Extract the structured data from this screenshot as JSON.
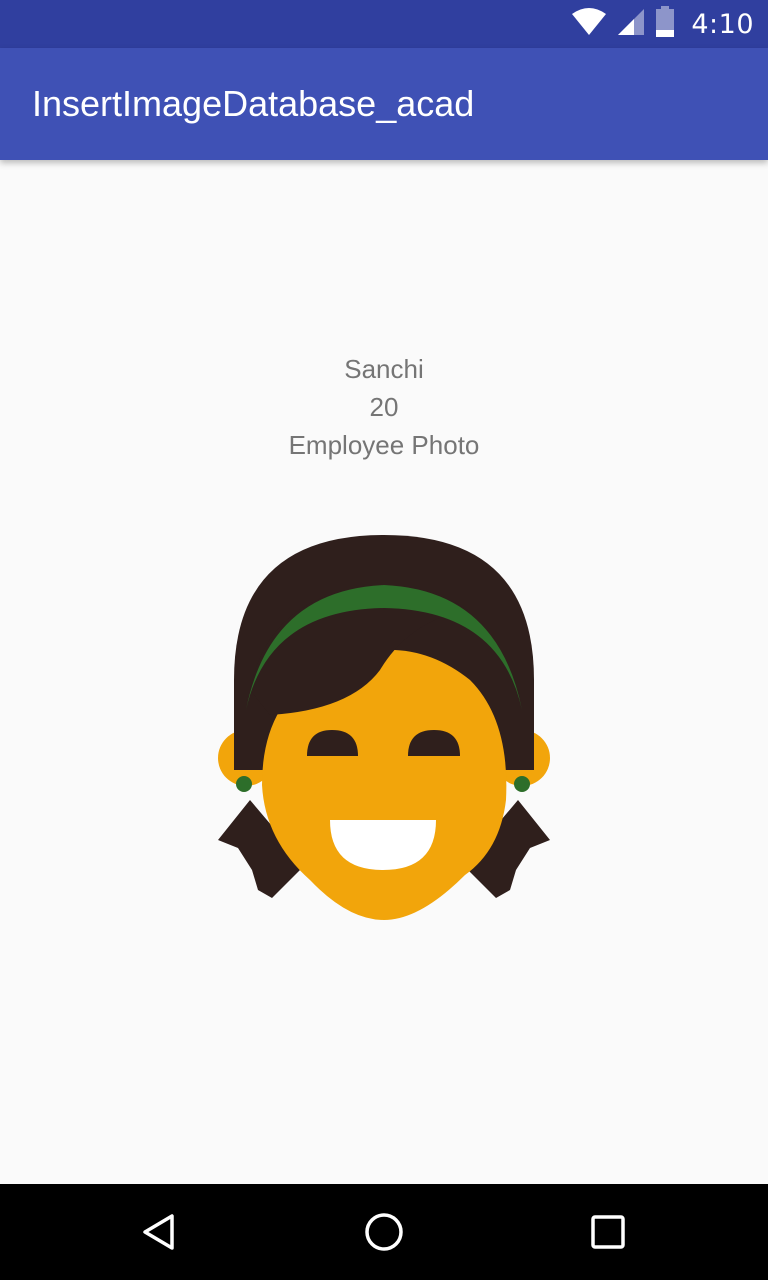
{
  "status_bar": {
    "time": "4:10",
    "icons": [
      "wifi-icon",
      "cell-signal-icon",
      "battery-icon"
    ],
    "color": "#303f9f"
  },
  "app_bar": {
    "title": "InsertImageDatabase_acad",
    "color": "#3f51b5"
  },
  "employee": {
    "name": "Sanchi",
    "age": "20",
    "photo_label": "Employee Photo",
    "photo_icon": "woman-face-avatar"
  },
  "nav_bar": {
    "buttons": [
      "back-icon",
      "home-icon",
      "recents-icon"
    ]
  },
  "colors": {
    "text_secondary": "#757575",
    "skin": "#f2a50b",
    "hair": "#2f1f1c",
    "headband": "#2d6e2a",
    "background": "#fafafa"
  }
}
